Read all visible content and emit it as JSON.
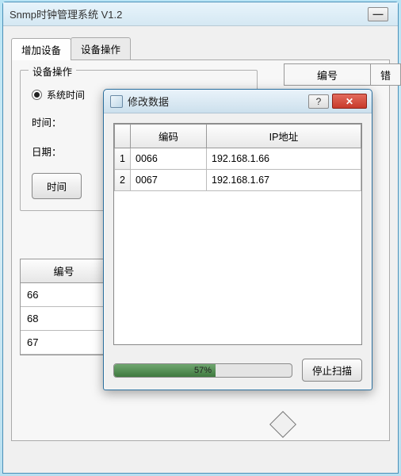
{
  "window": {
    "title": "Snmp时钟管理系统 V1.2",
    "min_label": "—"
  },
  "tabs": {
    "items": [
      {
        "label": "增加设备",
        "active": true
      },
      {
        "label": "设备操作",
        "active": false
      }
    ]
  },
  "groupbox": {
    "legend": "设备操作",
    "radio_sys_time": "系统时间",
    "time_label": "时间：",
    "date_label": "日期：",
    "time_button": "时间"
  },
  "right_header": {
    "col1": "编号",
    "col2": "错"
  },
  "list": {
    "header": "编号",
    "rows": [
      "66",
      "68",
      "67"
    ]
  },
  "dialog": {
    "title": "修改数据",
    "help": "?",
    "close": "✕",
    "table": {
      "headers": {
        "rownum": "",
        "code": "编码",
        "ip": "IP地址"
      },
      "rows": [
        {
          "n": "1",
          "code": "0066",
          "ip": "192.168.1.66"
        },
        {
          "n": "2",
          "code": "0067",
          "ip": "192.168.1.67"
        }
      ]
    },
    "progress": {
      "percent": 57,
      "label": "57%"
    },
    "stop_button": "停止扫描"
  }
}
